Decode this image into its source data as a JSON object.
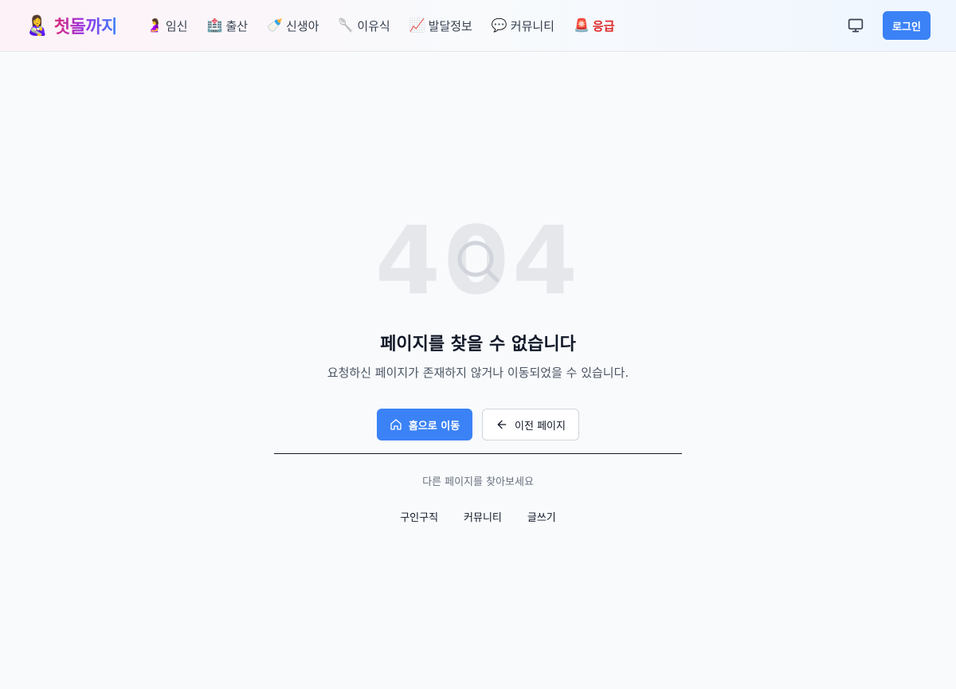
{
  "header": {
    "logo_emoji": "👩‍🍼",
    "logo_text": "첫돌까지",
    "nav": [
      {
        "emoji": "🤰",
        "label": "임신"
      },
      {
        "emoji": "🏥",
        "label": "출산"
      },
      {
        "emoji": "🍼",
        "label": "신생아"
      },
      {
        "emoji": "🥄",
        "label": "이유식"
      },
      {
        "emoji": "📈",
        "label": "발달정보"
      },
      {
        "emoji": "💬",
        "label": "커뮤니티"
      },
      {
        "emoji": "🚨",
        "label": "응급"
      }
    ],
    "display_icon": "monitor-icon",
    "login_label": "로그인"
  },
  "error": {
    "code": "404",
    "title": "페이지를 찾을 수 없습니다",
    "message": "요청하신 페이지가 존재하지 않거나 이동되었을 수 있습니다.",
    "home_button": "홈으로 이동",
    "back_button": "이전 페이지"
  },
  "suggestions": {
    "hint": "다른 페이지를 찾아보세요",
    "links": [
      "구인구직",
      "커뮤니티",
      "글쓰기"
    ]
  },
  "colors": {
    "accent": "#3b82f6",
    "emergency": "#dc2626",
    "background": "#f8fafc"
  }
}
